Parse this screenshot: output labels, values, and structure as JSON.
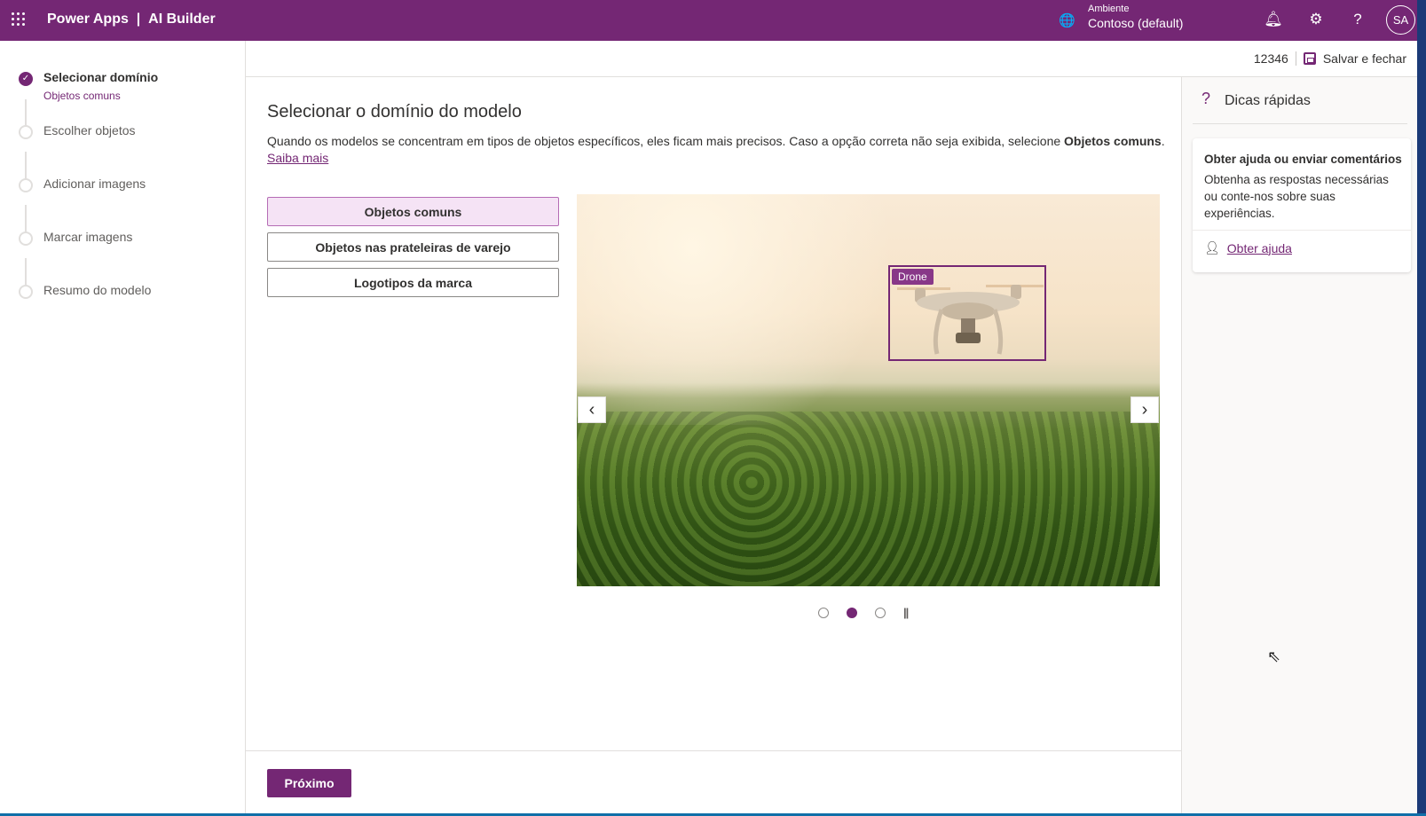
{
  "header": {
    "app": "Power Apps",
    "separator": "|",
    "product": "AI Builder",
    "env_label": "Ambiente",
    "env_name": "Contoso (default)",
    "avatar": "SA"
  },
  "steps": [
    {
      "label": "Selecionar domínio",
      "sub": "Objetos comuns",
      "done": true
    },
    {
      "label": "Escolher objetos"
    },
    {
      "label": "Adicionar imagens"
    },
    {
      "label": "Marcar imagens"
    },
    {
      "label": "Resumo do modelo"
    }
  ],
  "cmdbar": {
    "model_id": "12346",
    "save_close": "Salvar e fechar"
  },
  "main": {
    "title": "Selecionar o domínio do modelo",
    "desc": "Quando os modelos se concentram em tipos de objetos específicos, eles ficam mais precisos. Caso a opção correta não seja exibida, selecione ",
    "desc_bold": "Objetos comuns",
    "desc_end": ".",
    "learn_more": "Saiba mais",
    "options": [
      "Objetos comuns",
      "Objetos nas prateleiras de varejo",
      "Logotipos da marca"
    ],
    "selected_option": 0,
    "carousel": {
      "tag": "Drone",
      "prev": "‹",
      "next": "›",
      "slides": 3,
      "current": 2,
      "pause": "||"
    },
    "next_button": "Próximo"
  },
  "tips": {
    "title": "Dicas rápidas",
    "card_title": "Obter ajuda ou enviar comentários",
    "card_desc": "Obtenha as respostas necessárias ou conte-nos sobre suas experiências.",
    "card_link": "Obter ajuda"
  },
  "colors": {
    "brand": "#742774"
  }
}
